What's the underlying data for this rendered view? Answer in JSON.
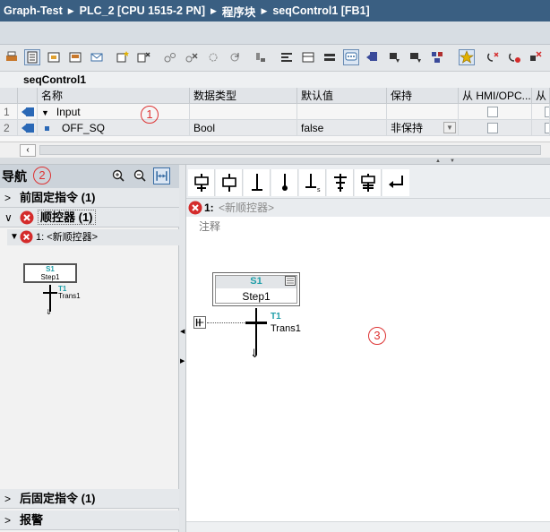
{
  "breadcrumb": [
    "Graph-Test",
    "PLC_2 [CPU 1515-2 PN]",
    "程序块",
    "seqControl1 [FB1]"
  ],
  "block_title": "seqControl1",
  "table": {
    "headers": [
      "名称",
      "数据类型",
      "默认值",
      "保持",
      "从 HMI/OPC...",
      "从 H"
    ],
    "rows": [
      {
        "num": "1",
        "name": "Input",
        "type": "",
        "default": "",
        "retain": ""
      },
      {
        "num": "2",
        "name": "OFF_SQ",
        "type": "Bool",
        "default": "false",
        "retain": "非保持"
      }
    ]
  },
  "callouts": [
    "1",
    "2",
    "3"
  ],
  "nav": {
    "title": "导航",
    "sections": [
      {
        "label": "前固定指令 (1)",
        "arrow": ">"
      },
      {
        "label": "顺控器 (1)",
        "arrow": "∨"
      },
      {
        "label": "后固定指令 (1)",
        "arrow": ">"
      },
      {
        "label": "报警",
        "arrow": ">"
      }
    ],
    "sequence_item": "1: <新顺控器>",
    "mini_step": {
      "name": "S1",
      "label": "Step1"
    },
    "mini_trans": {
      "name": "T1",
      "label": "Trans1"
    }
  },
  "editor": {
    "sequence_num": "1:",
    "sequence_name": "<新顺控器>",
    "comment": "注释",
    "step": {
      "name": "S1",
      "label": "Step1"
    },
    "transition": {
      "name": "T1",
      "label": "Trans1"
    }
  },
  "colors": {
    "titlebar": "#3a5f82",
    "error": "#d42b2b",
    "step_name": "#1f9ea8",
    "callout": "#d33333"
  }
}
